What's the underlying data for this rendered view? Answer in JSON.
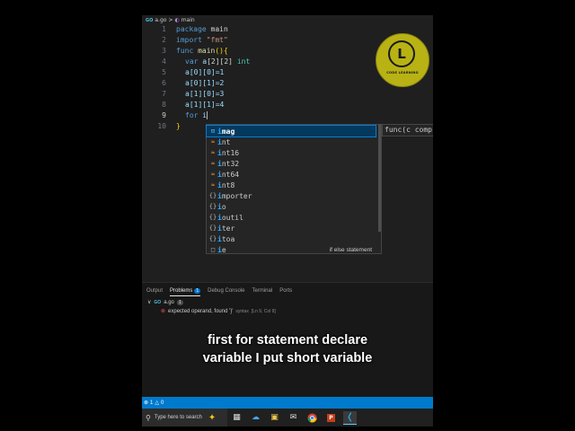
{
  "breadcrumb": {
    "file_icon": "go-file-icon",
    "file_icon_text": "GO",
    "file": "a.go",
    "separator": ">",
    "symbol": "main"
  },
  "editor": {
    "line_numbers": [
      "1",
      "2",
      "3",
      "4",
      "5",
      "6",
      "7",
      "8",
      "9",
      "10"
    ],
    "lines": {
      "l1_kw": "package",
      "l1_name": " main",
      "l2_kw": "import",
      "l2_str": " \"fmt\"",
      "l3_kw": "func",
      "l3_fn": " main",
      "l3_br": "(){",
      "l4_kw": "var",
      "l4_var": " a",
      "l4_dims": "[2][2]",
      "l4_ty": " int",
      "l5": "a[0][0]=1",
      "l6": "a[0][1]=2",
      "l7": "a[1][0]=3",
      "l8": "a[1][1]=4",
      "l9_kw": "for",
      "l9_typed": " i",
      "l10": "}"
    }
  },
  "logo": {
    "letter": "L",
    "text": "CODE LEARNING"
  },
  "suggestions": {
    "items": [
      {
        "icon": "struct-icon",
        "match": "i",
        "rest": "mag",
        "selected": true
      },
      {
        "icon": "keyword-icon",
        "match": "i",
        "rest": "nt"
      },
      {
        "icon": "keyword-icon",
        "match": "i",
        "rest": "nt16"
      },
      {
        "icon": "keyword-icon",
        "match": "i",
        "rest": "nt32"
      },
      {
        "icon": "keyword-icon",
        "match": "i",
        "rest": "nt64"
      },
      {
        "icon": "keyword-icon",
        "match": "i",
        "rest": "nt8"
      },
      {
        "icon": "module-icon",
        "match": "i",
        "rest": "mporter"
      },
      {
        "icon": "module-icon",
        "match": "i",
        "rest": "o"
      },
      {
        "icon": "module-icon",
        "match": "i",
        "rest": "outil"
      },
      {
        "icon": "module-icon",
        "match": "i",
        "rest": "ter"
      },
      {
        "icon": "module-icon",
        "match": "i",
        "rest": "toa"
      },
      {
        "icon": "snippet-icon",
        "match": "i",
        "rest": "e",
        "hint": "if else statement"
      }
    ],
    "detail": "func(c comp"
  },
  "panel": {
    "tabs": [
      "Output",
      "Problems",
      "Debug Console",
      "Terminal",
      "Ports"
    ],
    "problems_count": "1",
    "file": "a.go",
    "file_count": "1",
    "problem": {
      "message": "expected operand, found '}'",
      "source": "syntax",
      "location": "[Ln 9, Col 9]"
    }
  },
  "caption": {
    "line1": "first for statement declare",
    "line2": "variable I put short variable"
  },
  "statusbar": {
    "errors": "1",
    "warnings": "0"
  },
  "taskbar": {
    "search_placeholder": "Type here to search"
  },
  "colors": {
    "accent": "#007acc",
    "logo": "#b8b214",
    "error": "#f14c4c"
  }
}
